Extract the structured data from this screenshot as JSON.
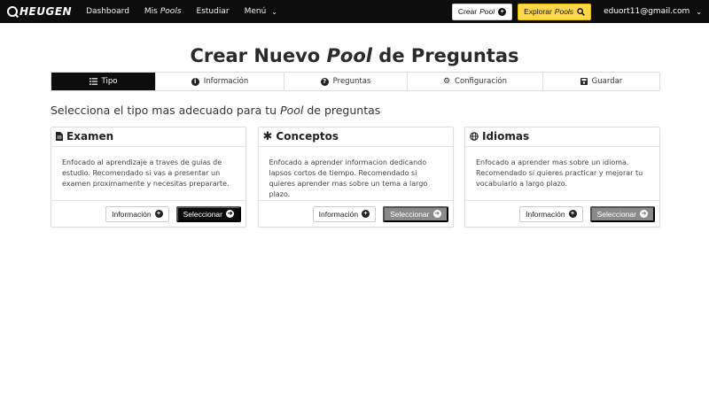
{
  "navbar": {
    "brand": "HEUGEN",
    "links": [
      {
        "label": "Dashboard"
      },
      {
        "label_prefix": "Mis ",
        "label_em": "Pools"
      },
      {
        "label": "Estudiar"
      },
      {
        "label": "Menú"
      }
    ],
    "create_prefix": "Crear ",
    "create_em": "Pool",
    "explore_prefix": "Explorar ",
    "explore_em": "Pools",
    "user_email": "eduort11@gmail.com"
  },
  "title": {
    "prefix": "Crear Nuevo ",
    "em": "Pool",
    "suffix": " de Preguntas"
  },
  "steps": [
    {
      "label": "Tipo",
      "icon": "list-icon",
      "active": true
    },
    {
      "label": "Información",
      "icon": "info-icon",
      "active": false
    },
    {
      "label": "Preguntas",
      "icon": "question-icon",
      "active": false
    },
    {
      "label": "Configuración",
      "icon": "gears-icon",
      "active": false
    },
    {
      "label": "Guardar",
      "icon": "save-icon",
      "active": false
    }
  ],
  "subtitle": {
    "prefix": "Selecciona el tipo mas adecuado para tu ",
    "em": "Pool",
    "suffix": " de preguntas"
  },
  "cards": [
    {
      "title": "Examen",
      "icon": "file-icon",
      "description": "Enfocado al aprendizaje a traves de guias de estudio. Recomendado si vas a presentar un examen proximamente y necesitas prepararte.",
      "info_label": "Información",
      "select_label": "Seleccionar",
      "selected": true
    },
    {
      "title": "Conceptos",
      "icon": "asterisk-icon",
      "description": "Enfocado a aprender informacion dedicando lapsos cortos de tiempo. Recomendado si quieres aprender mas sobre un tema a largo plazo.",
      "info_label": "Información",
      "select_label": "Seleccionar",
      "selected": false
    },
    {
      "title": "Idiomas",
      "icon": "globe-icon",
      "description": "Enfocado a aprender mas sobre un idioma. Recomendado si quieres practicar y mejorar tu vocabulario a largo plazo.",
      "info_label": "Información",
      "select_label": "Seleccionar",
      "selected": false
    }
  ],
  "colors": {
    "navbar_bg": "#0d0d0d",
    "explore_accent": "#ffd84d",
    "select_active": "#0d0d0d",
    "select_inactive": "#8a8a8a"
  }
}
